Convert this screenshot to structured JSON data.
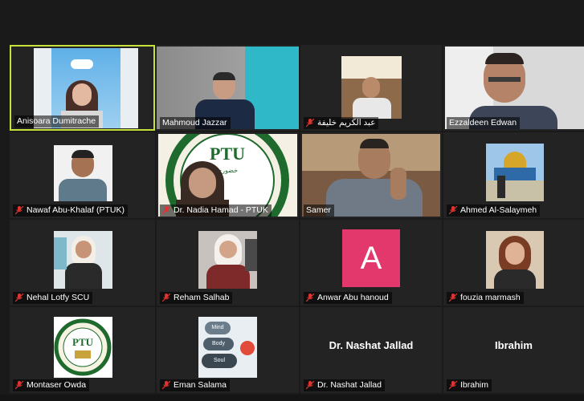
{
  "participants": [
    {
      "name": "Anisoara Dumitrache",
      "muted": false,
      "active": true
    },
    {
      "name": "Mahmoud Jazzar",
      "muted": false,
      "active": false
    },
    {
      "name": "عبد الكريم خليفة",
      "muted": true,
      "active": false
    },
    {
      "name": "Ezzaldeen Edwan",
      "muted": false,
      "active": false
    },
    {
      "name": "Nawaf Abu-Khalaf (PTUK)",
      "muted": true,
      "active": false
    },
    {
      "name": "Dr. Nadia Hamad - PTUK",
      "muted": true,
      "active": false
    },
    {
      "name": "Samer",
      "muted": false,
      "active": false
    },
    {
      "name": "Ahmed Al-Salaymeh",
      "muted": true,
      "active": false
    },
    {
      "name": "Nehal Lotfy SCU",
      "muted": true,
      "active": false
    },
    {
      "name": "Reham Salhab",
      "muted": true,
      "active": false
    },
    {
      "name": "Anwar Abu hanoud",
      "muted": true,
      "active": false,
      "avatar_letter": "A"
    },
    {
      "name": "fouzia marmash",
      "muted": true,
      "active": false
    },
    {
      "name": "Montaser Owda",
      "muted": true,
      "active": false
    },
    {
      "name": "Eman Salama",
      "muted": true,
      "active": false
    },
    {
      "name": "Dr. Nashat Jallad",
      "muted": true,
      "active": false,
      "center_name": "Dr. Nashat Jallad"
    },
    {
      "name": "Ibrahim",
      "muted": true,
      "active": false,
      "center_name": "Ibrahim"
    }
  ],
  "logos": {
    "ptu_text": "PTU",
    "ptu_small": "خضوري"
  },
  "mind_body_soul": [
    "Mind",
    "Body",
    "Soul"
  ],
  "colors": {
    "active_border": "#c8e03a",
    "avatar_bg": "#e3386b",
    "mute_red": "#e0332f"
  }
}
